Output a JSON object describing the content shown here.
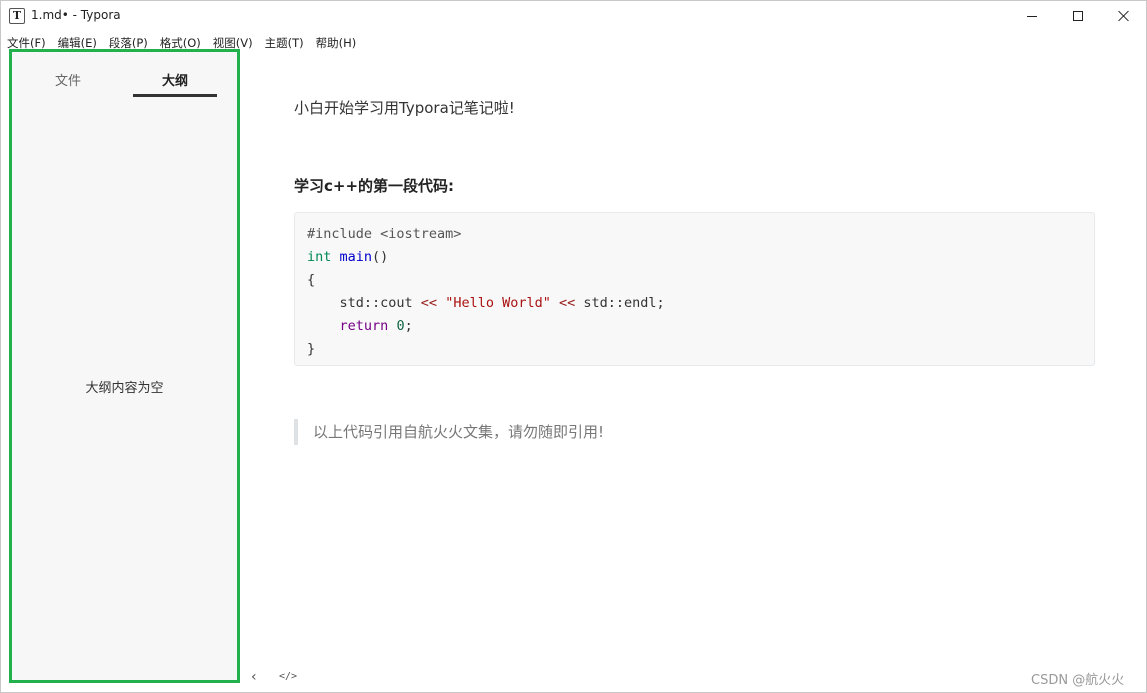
{
  "window": {
    "title": "1.md• - Typora",
    "app_icon_letter": "T",
    "controls": {
      "minimize": "minimize-icon",
      "maximize": "maximize-icon",
      "close": "close-icon"
    }
  },
  "menu": [
    "文件(F)",
    "编辑(E)",
    "段落(P)",
    "格式(O)",
    "视图(V)",
    "主题(T)",
    "帮助(H)"
  ],
  "sidebar": {
    "tabs": [
      {
        "label": "文件",
        "active": false
      },
      {
        "label": "大纲",
        "active": true
      }
    ],
    "empty_message": "大纲内容为空",
    "highlight_color": "#22b14c"
  },
  "document": {
    "paragraph": "小白开始学习用Typora记笔记啦!",
    "heading": "学习c++的第一段代码:",
    "code": {
      "line1": "#include <iostream>",
      "line2_type": "int",
      "line2_func": "main",
      "line2_rest": "()",
      "line3": "{",
      "line4_a": "    std::cout ",
      "line4_op1": "<<",
      "line4_str": "\"Hello World\"",
      "line4_op2": "<<",
      "line4_b": " std::endl;",
      "line5_kw": "return",
      "line5_num": "0",
      "line5_end": ";",
      "line6": "}"
    },
    "blockquote": "以上代码引用自航火火文集，请勿随即引用!"
  },
  "footer": {
    "toggle_sidebar_icon": "chevron-left-icon",
    "source_mode_label": "</>",
    "watermark": "CSDN @航火火"
  }
}
